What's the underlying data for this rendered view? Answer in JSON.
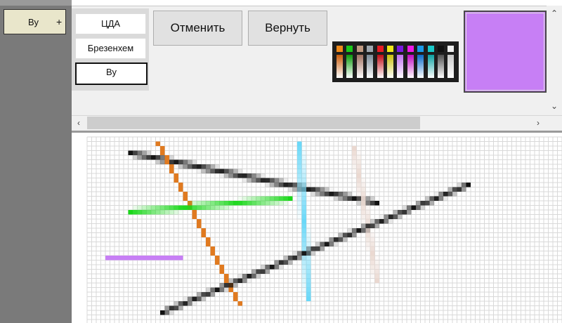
{
  "left_panel": {
    "tab_label": "Ву",
    "tab_add": "+"
  },
  "algorithms": [
    {
      "label": "ЦДА",
      "selected": false
    },
    {
      "label": "Брезенхем",
      "selected": false
    },
    {
      "label": "Ву",
      "selected": true
    }
  ],
  "toolbar": {
    "undo_label": "Отменить",
    "redo_label": "Вернуть"
  },
  "palette": {
    "top_row": [
      "#f08a1a",
      "#1ac81a",
      "#c09a82",
      "#a0a8b0",
      "#e81c24",
      "#f0e81a",
      "#7a1ae0",
      "#f01ae8",
      "#1a9ae8",
      "#1ac8c8",
      "#101010",
      "#f0f0f0"
    ],
    "bottom_row": [
      "#c85a0a",
      "#0a9a0a",
      "#a07060",
      "#7a8a98",
      "#c00a14",
      "#c8c00a",
      "#c070f0",
      "#c00ac0",
      "#0a6ac8",
      "#0aa0a0",
      "#505050",
      "#c8c8c8"
    ]
  },
  "current_color": "#c77ff5",
  "canvas_lines": [
    {
      "color": "#111111",
      "wu": true
    },
    {
      "color": "#e07a20",
      "wu": false
    },
    {
      "color": "#1ad81a",
      "wu": true
    },
    {
      "color": "#6ad8f8",
      "wu": true
    },
    {
      "color": "#ead8d0",
      "wu": true
    },
    {
      "color": "#111111",
      "wu": true
    },
    {
      "color": "#c77ff5",
      "wu": false
    }
  ]
}
